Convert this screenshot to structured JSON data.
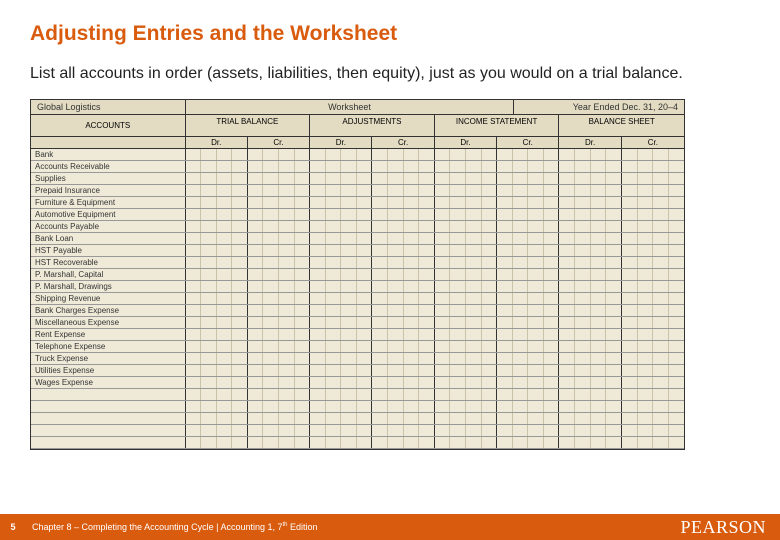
{
  "title": "Adjusting Entries and the Worksheet",
  "body": "List all accounts in order (assets, liabilities, then equity), just as you would on a trial balance.",
  "worksheet": {
    "company": "Global Logistics",
    "label": "Worksheet",
    "period": "Year Ended Dec. 31, 20–4",
    "accounts_header": "ACCOUNTS",
    "groups": [
      "TRIAL BALANCE",
      "ADJUSTMENTS",
      "INCOME STATEMENT",
      "BALANCE SHEET"
    ],
    "drcr": [
      "Dr.",
      "Cr."
    ],
    "accounts": [
      "Bank",
      "Accounts Receivable",
      "Supplies",
      "Prepaid Insurance",
      "Furniture & Equipment",
      "Automotive Equipment",
      "Accounts Payable",
      "Bank Loan",
      "HST Payable",
      "HST Recoverable",
      "P. Marshall, Capital",
      "P. Marshall, Drawings",
      "Shipping Revenue",
      "Bank Charges Expense",
      "Miscellaneous Expense",
      "Rent Expense",
      "Telephone Expense",
      "Truck Expense",
      "Utilities Expense",
      "Wages Expense",
      "",
      "",
      "",
      "",
      ""
    ]
  },
  "footer": {
    "page": "5",
    "chapter": "Chapter 8 – Completing the Accounting Cycle | Accounting 1, 7",
    "edition_suffix": " Edition",
    "brand": "PEARSON"
  }
}
